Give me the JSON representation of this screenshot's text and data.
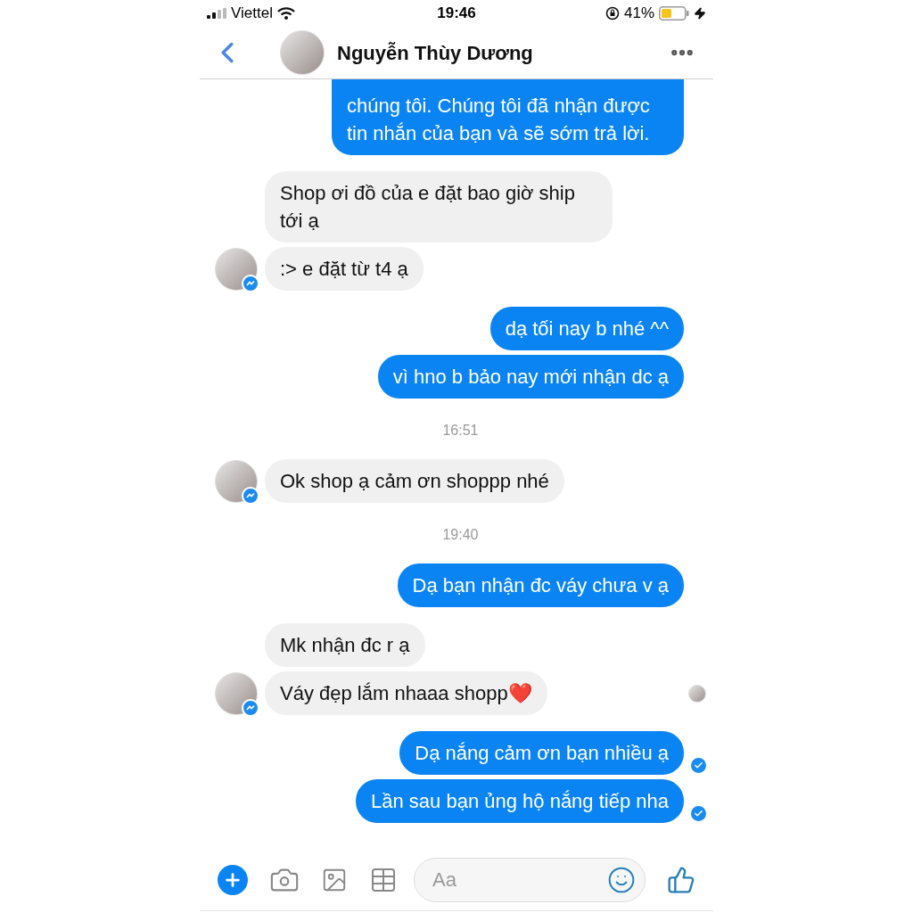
{
  "status_bar": {
    "carrier": "Viettel",
    "time": "19:46",
    "battery": "41%"
  },
  "header": {
    "name": "Nguyễn Thùy Dương"
  },
  "messages": [
    {
      "kind": "sent",
      "text": "chúng tôi. Chúng tôi đã nhận được tin nhắn của bạn và sẽ sớm trả lời.",
      "cut_top": true,
      "delivered": false
    },
    {
      "kind": "received",
      "text": "Shop ơi đồ của e đặt bao giờ ship tới ạ",
      "avatar": false,
      "seen": false
    },
    {
      "kind": "received",
      "text": ":> e đặt từ t4 ạ",
      "avatar": true,
      "seen": false
    },
    {
      "kind": "sent",
      "text": "dạ tối nay b nhé ^^",
      "cut_top": false,
      "delivered": false
    },
    {
      "kind": "sent",
      "text": "vì hno b bảo nay mới nhận dc ạ",
      "cut_top": false,
      "delivered": false
    },
    {
      "kind": "time",
      "text": "16:51"
    },
    {
      "kind": "received",
      "text": "Ok shop ạ cảm ơn shoppp nhé",
      "avatar": true,
      "seen": false
    },
    {
      "kind": "time",
      "text": "19:40"
    },
    {
      "kind": "sent",
      "text": "Dạ bạn nhận đc váy chưa v ạ",
      "cut_top": false,
      "delivered": false
    },
    {
      "kind": "received",
      "text": "Mk nhận đc r ạ",
      "avatar": false,
      "seen": false
    },
    {
      "kind": "received",
      "text": "Váy đẹp lắm nhaaa shopp❤️",
      "avatar": true,
      "seen": true
    },
    {
      "kind": "sent",
      "text": "Dạ nắng cảm ơn bạn nhiều ạ",
      "cut_top": false,
      "delivered": true
    },
    {
      "kind": "sent",
      "text": "Lần sau bạn ủng hộ nắng tiếp nha",
      "cut_top": false,
      "delivered": true
    }
  ],
  "composer": {
    "placeholder": "Aa"
  }
}
